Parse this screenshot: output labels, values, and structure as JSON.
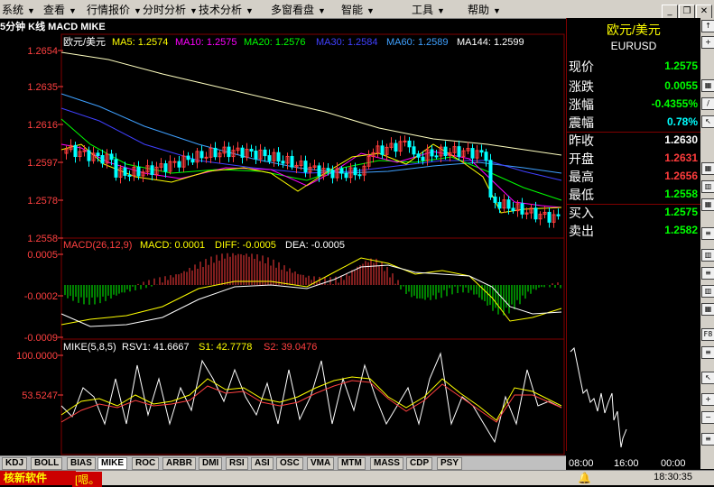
{
  "menu": [
    {
      "label": "系统"
    },
    {
      "label": "查看"
    },
    {
      "label": "行情报价"
    },
    {
      "label": "分时分析"
    },
    {
      "label": "技术分析"
    },
    {
      "label": "多窗看盘"
    },
    {
      "label": "智能"
    },
    {
      "label": "工具"
    },
    {
      "label": "帮助"
    }
  ],
  "window": {
    "minimize": "_",
    "restore": "❐",
    "close": "✕"
  },
  "chart_title": "5分钟 K线 MACD MIKE",
  "ma_legend": {
    "name": "欧元/美元",
    "ma5": "MA5: 1.2574",
    "ma10": "MA10: 1.2575",
    "ma20": "MA20: 1.2576",
    "ma30": "MA30: 1.2584",
    "ma60": "MA60: 1.2589",
    "ma144": "MA144: 1.2599"
  },
  "price_axis": [
    "1.2654",
    "1.2635",
    "1.2616",
    "1.2597",
    "1.2578",
    "1.2558"
  ],
  "macd_legend": {
    "name": "MACD(26,12,9)",
    "macd": "MACD: 0.0001",
    "diff": "DIFF: -0.0005",
    "dea": "DEA: -0.0005"
  },
  "macd_axis": [
    "0.0005",
    "-0.0002",
    "-0.0009"
  ],
  "mike_legend": {
    "name": "MIKE(5,8,5)",
    "rsv": "RSV1: 41.6667",
    "s1": "S1: 42.7778",
    "s2": "S2: 39.0476"
  },
  "mike_axis": [
    "100.0000",
    "53.5247"
  ],
  "colors": {
    "up": "#ff3c3c",
    "down": "#00ffff",
    "ma5": "#ffff00",
    "ma10": "#ff00ff",
    "ma20": "#00ff00",
    "ma30": "#0000ff",
    "ma60": "#3fa0ff",
    "ma144": "#ffffc0"
  },
  "panel": {
    "title": "欧元/美元",
    "symbol": "EURUSD",
    "rows": [
      {
        "label": "现价",
        "value": "1.2575",
        "color": "#00ff00"
      },
      {
        "label": "涨跌",
        "value": "0.0055",
        "color": "#00ff00"
      },
      {
        "label": "涨幅",
        "value": "-0.4355%",
        "color": "#00ff00"
      },
      {
        "label": "震幅",
        "value": "0.78%",
        "color": "#00ffff"
      },
      {
        "label": "昨收",
        "value": "1.2630",
        "color": "#ffffff"
      },
      {
        "label": "开盘",
        "value": "1.2631",
        "color": "#ff3c3c"
      },
      {
        "label": "最高",
        "value": "1.2656",
        "color": "#ff3c3c"
      },
      {
        "label": "最低",
        "value": "1.2558",
        "color": "#00ff00"
      },
      {
        "label": "买入",
        "value": "1.2575",
        "color": "#00ff00"
      },
      {
        "label": "卖出",
        "value": "1.2582",
        "color": "#00ff00"
      }
    ],
    "mini_times": [
      "08:00",
      "16:00",
      "00:00"
    ]
  },
  "tabs": [
    "KDJ",
    "BOLL",
    "BIAS",
    "MIKE",
    "ROC",
    "ARBR",
    "DMI",
    "RSI",
    "ASI",
    "OSC",
    "VMA",
    "MTM",
    "MASS",
    "CDP",
    "PSY"
  ],
  "active_tab": "MIKE",
  "toolbar_icons": [
    "F8"
  ],
  "status": {
    "brand": "核新软件",
    "ticker": "[嗯。",
    "time": "18:30:35"
  }
}
